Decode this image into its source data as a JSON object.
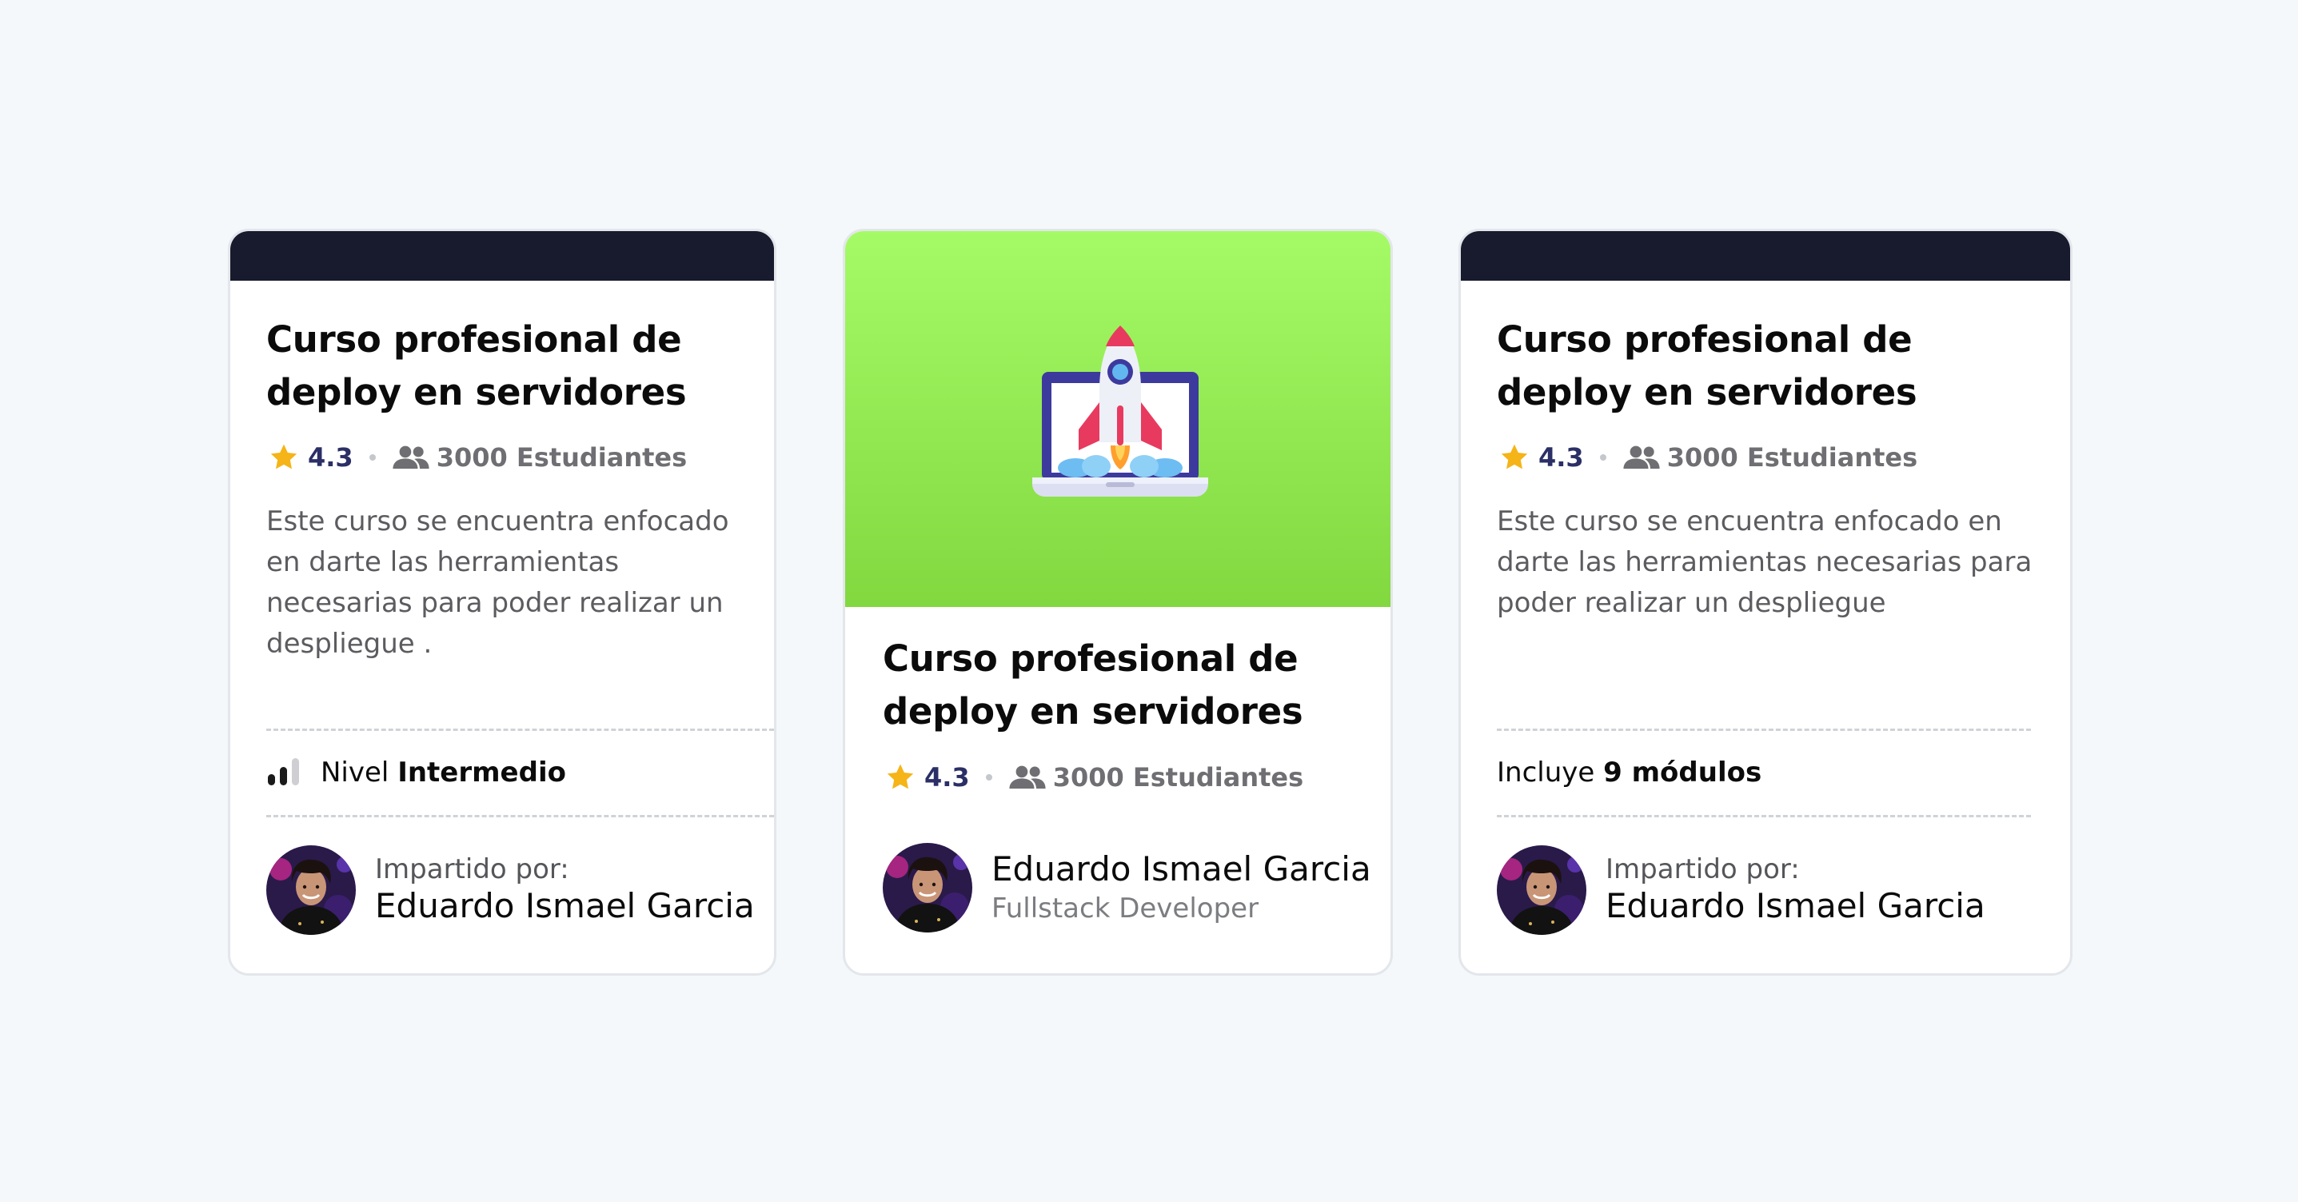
{
  "colors": {
    "page_bg": "#f5f8fb",
    "dark_bar": "#181a2e",
    "hero_gradient_top": "#a5fb66",
    "hero_gradient_bottom": "#82d83f",
    "star": "#f5b417",
    "rating_text": "#2b2f66"
  },
  "cards": [
    {
      "title": "Curso profesional de deploy en servidores",
      "rating": "4.3",
      "students": "3000 Estudiantes",
      "description": "Este curso se encuentra enfocado en darte las herramientas necesarias para poder realizar un despliegue .",
      "level_prefix": "Nivel ",
      "level_value": "Intermedio",
      "instructor_label": "Impartido por:",
      "instructor_name": "Eduardo Ismael Garcia",
      "icons": [
        "star-icon",
        "people-icon",
        "level-bars-icon"
      ]
    },
    {
      "title": "Curso profesional de deploy en servidores",
      "rating": "4.3",
      "students": "3000 Estudiantes",
      "instructor_name": "Eduardo Ismael Garcia",
      "instructor_role": "Fullstack Developer",
      "icons": [
        "rocket-laptop-illustration",
        "star-icon",
        "people-icon"
      ]
    },
    {
      "title": "Curso profesional de deploy en servidores",
      "rating": "4.3",
      "students": "3000 Estudiantes",
      "description": "Este curso se encuentra enfocado en darte las herramientas necesarias para poder realizar un despliegue",
      "modules_prefix": "Incluye ",
      "modules_value": "9 módulos",
      "instructor_label": "Impartido por:",
      "instructor_name": "Eduardo Ismael Garcia",
      "icons": [
        "star-icon",
        "people-icon"
      ]
    }
  ]
}
